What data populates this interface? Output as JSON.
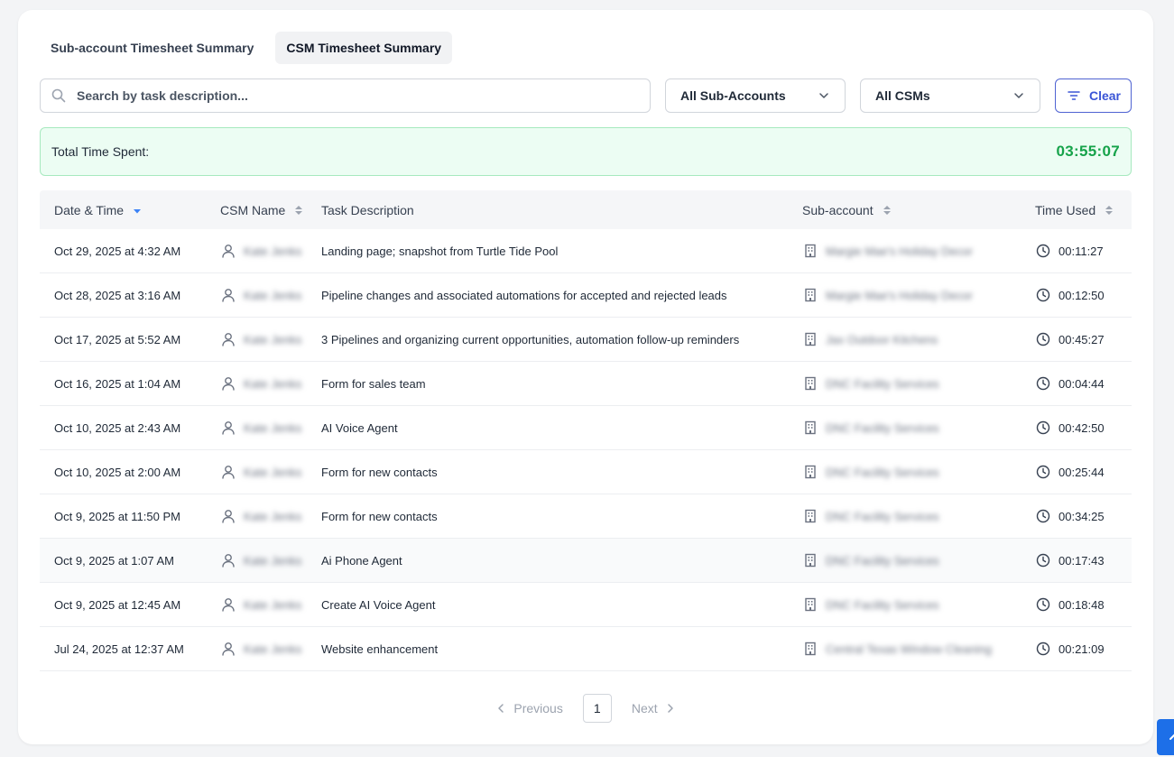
{
  "tabs": [
    {
      "label": "Sub-account Timesheet Summary",
      "active": false
    },
    {
      "label": "CSM Timesheet Summary",
      "active": true
    }
  ],
  "filters": {
    "search_placeholder": "Search by task description...",
    "sub_accounts_value": "All Sub-Accounts",
    "csms_value": "All CSMs",
    "clear_label": "Clear"
  },
  "summary": {
    "label": "Total Time Spent:",
    "value": "03:55:07"
  },
  "table": {
    "headers": {
      "date": "Date & Time",
      "csm": "CSM Name",
      "task": "Task Description",
      "subaccount": "Sub-account",
      "time": "Time Used"
    },
    "rows": [
      {
        "date": "Oct 29, 2025 at 4:32 AM",
        "csm": "Kate Jenks",
        "task": "Landing page; snapshot from Turtle Tide Pool",
        "subaccount": "Margie Mae's Holiday Decor",
        "time": "00:11:27"
      },
      {
        "date": "Oct 28, 2025 at 3:16 AM",
        "csm": "Kate Jenks",
        "task": "Pipeline changes and associated automations for accepted and rejected leads",
        "subaccount": "Margie Mae's Holiday Decor",
        "time": "00:12:50"
      },
      {
        "date": "Oct 17, 2025 at 5:52 AM",
        "csm": "Kate Jenks",
        "task": "3 Pipelines and organizing current opportunities, automation follow-up reminders",
        "subaccount": "Jax Outdoor Kitchens",
        "time": "00:45:27"
      },
      {
        "date": "Oct 16, 2025 at 1:04 AM",
        "csm": "Kate Jenks",
        "task": "Form for sales team",
        "subaccount": "DNC Facility Services",
        "time": "00:04:44"
      },
      {
        "date": "Oct 10, 2025 at 2:43 AM",
        "csm": "Kate Jenks",
        "task": "AI Voice Agent",
        "subaccount": "DNC Facility Services",
        "time": "00:42:50"
      },
      {
        "date": "Oct 10, 2025 at 2:00 AM",
        "csm": "Kate Jenks",
        "task": "Form for new contacts",
        "subaccount": "DNC Facility Services",
        "time": "00:25:44"
      },
      {
        "date": "Oct 9, 2025 at 11:50 PM",
        "csm": "Kate Jenks",
        "task": "Form for new contacts",
        "subaccount": "DNC Facility Services",
        "time": "00:34:25"
      },
      {
        "date": "Oct 9, 2025 at 1:07 AM",
        "csm": "Kate Jenks",
        "task": "Ai Phone Agent",
        "subaccount": "DNC Facility Services",
        "time": "00:17:43"
      },
      {
        "date": "Oct 9, 2025 at 12:45 AM",
        "csm": "Kate Jenks",
        "task": "Create AI Voice Agent",
        "subaccount": "DNC Facility Services",
        "time": "00:18:48"
      },
      {
        "date": "Jul 24, 2025 at 12:37 AM",
        "csm": "Kate Jenks",
        "task": "Website enhancement",
        "subaccount": "Central Texas Window Cleaning",
        "time": "00:21:09"
      }
    ]
  },
  "pagination": {
    "previous_label": "Previous",
    "current_page": "1",
    "next_label": "Next"
  },
  "colors": {
    "accent": "#3b55d6",
    "success": "#16a34a",
    "success_bg": "#ecfdf3"
  }
}
